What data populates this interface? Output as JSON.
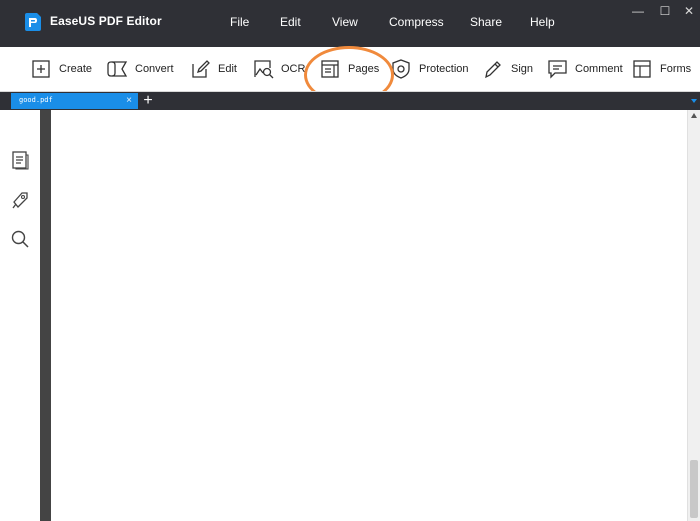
{
  "app": {
    "name": "EaseUS PDF Editor",
    "logo_icon": "easeus-pdf-logo-icon",
    "accent_color": "#1a8ee8",
    "highlight_color": "#f08a3c"
  },
  "menu": [
    {
      "label": "File"
    },
    {
      "label": "Edit"
    },
    {
      "label": "View"
    },
    {
      "label": "Compress"
    },
    {
      "label": "Share"
    },
    {
      "label": "Help"
    }
  ],
  "window_controls": {
    "minimize": "—",
    "maximize": "☐",
    "close": "✕"
  },
  "toolbar": [
    {
      "label": "Create",
      "icon": "plus-square-icon"
    },
    {
      "label": "Convert",
      "icon": "convert-icon"
    },
    {
      "label": "Edit",
      "icon": "edit-pen-icon"
    },
    {
      "label": "OCR",
      "icon": "ocr-icon"
    },
    {
      "label": "Pages",
      "icon": "pages-icon"
    },
    {
      "label": "Protection",
      "icon": "shield-icon"
    },
    {
      "label": "Sign",
      "icon": "sign-pen-icon"
    },
    {
      "label": "Comment",
      "icon": "comment-icon"
    },
    {
      "label": "Forms",
      "icon": "forms-icon"
    }
  ],
  "tabs": [
    {
      "label": "good.pdf",
      "close": "×"
    }
  ],
  "add_tab": "+",
  "side_panel": [
    {
      "icon": "thumbnails-icon"
    },
    {
      "icon": "bookmark-icon"
    },
    {
      "icon": "search-icon"
    }
  ]
}
